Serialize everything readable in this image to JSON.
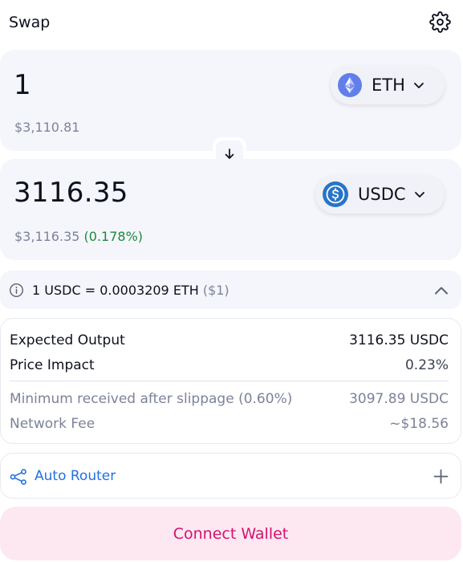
{
  "header": {
    "title": "Swap",
    "settings_icon": "gear-icon"
  },
  "input_panel": {
    "amount": "1",
    "usd_value": "$3,110.81",
    "token": {
      "symbol": "ETH",
      "icon": "eth-icon",
      "color": "#627eea"
    }
  },
  "switch": {
    "icon": "arrow-down-icon"
  },
  "output_panel": {
    "amount": "3116.35",
    "usd_value": "$3,116.35",
    "price_change": "(0.178%)",
    "token": {
      "symbol": "USDC",
      "icon": "usdc-icon",
      "color": "#2775ca"
    }
  },
  "rate_bar": {
    "rate": "1 USDC = 0.0003209 ETH",
    "rate_usd": "($1)",
    "icons": [
      "info-icon",
      "chevron-up-icon"
    ]
  },
  "details": {
    "rows": [
      {
        "label": "Expected Output",
        "value": "3116.35 USDC"
      },
      {
        "label": "Price Impact",
        "value": "0.23%"
      },
      {
        "label": "Minimum received after slippage (0.60%)",
        "value": "3097.89 USDC"
      },
      {
        "label": "Network Fee",
        "value": "~$18.56"
      }
    ]
  },
  "router": {
    "label": "Auto Router",
    "icon": "route-icon",
    "expand_icon": "plus-icon"
  },
  "connect_button": {
    "label": "Connect Wallet",
    "bg": "#fde8f1",
    "color": "#d5126f"
  }
}
